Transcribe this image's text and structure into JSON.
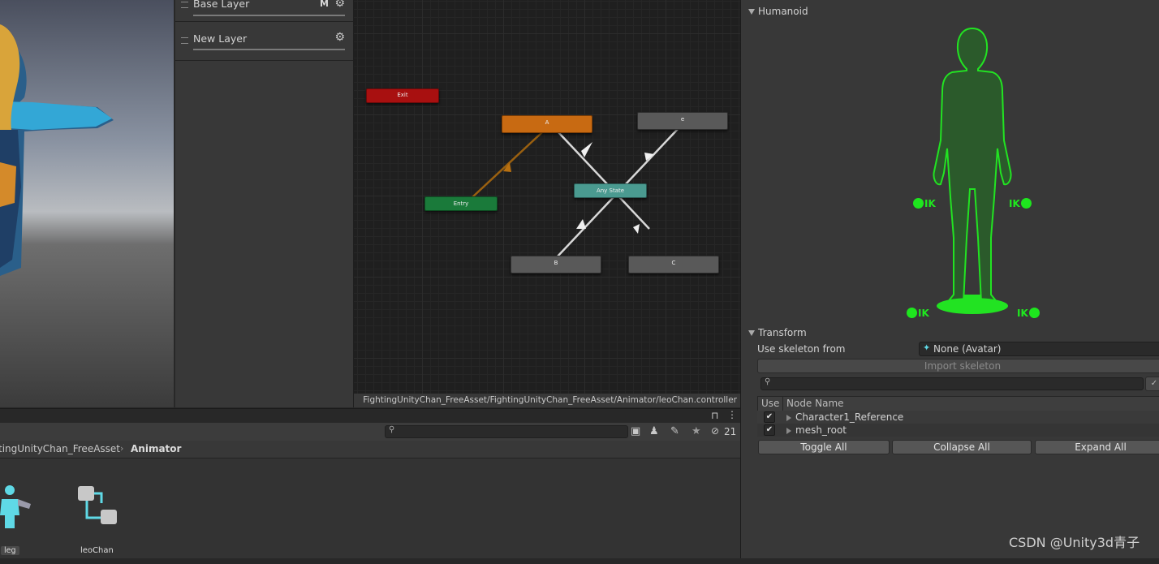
{
  "layers": {
    "base": {
      "name": "Base Layer",
      "m": "M"
    },
    "new": {
      "name": "New Layer"
    }
  },
  "animator": {
    "states": {
      "exit": "Exit",
      "a": "A",
      "e": "e",
      "entry": "Entry",
      "any": "Any State",
      "b": "B",
      "c": "C"
    },
    "path": "FightingUnityChan_FreeAsset/FightingUnityChan_FreeAsset/Animator/leoChan.controller",
    "colors": {
      "exit": "#a81010",
      "a": "#c86a12",
      "entry": "#1a7a3a",
      "any": "#4a9a90",
      "grey": "#5a5a5a"
    }
  },
  "project": {
    "hidden_count": "21",
    "breadcrumb": {
      "prefix": "tingUnityChan_FreeAsset",
      "current": "Animator"
    },
    "assets": [
      {
        "label": "leg",
        "icon": "avatar-mask-icon"
      },
      {
        "label": "leoChan",
        "icon": "animator-controller-icon"
      }
    ]
  },
  "inspector": {
    "humanoid_label": "Humanoid",
    "ik_label": "IK",
    "transform_label": "Transform",
    "use_skeleton_label": "Use skeleton from",
    "skeleton_value": "None (Avatar)",
    "import_skeleton": "Import skeleton",
    "col_use": "Use",
    "col_node": "Node Name",
    "rows": [
      {
        "name": "Character1_Reference",
        "checked": true
      },
      {
        "name": "mesh_root",
        "checked": true
      }
    ],
    "toggle_all": "Toggle All",
    "collapse_all": "Collapse All",
    "expand_all": "Expand All"
  },
  "watermark": "CSDN @Unity3d青子"
}
